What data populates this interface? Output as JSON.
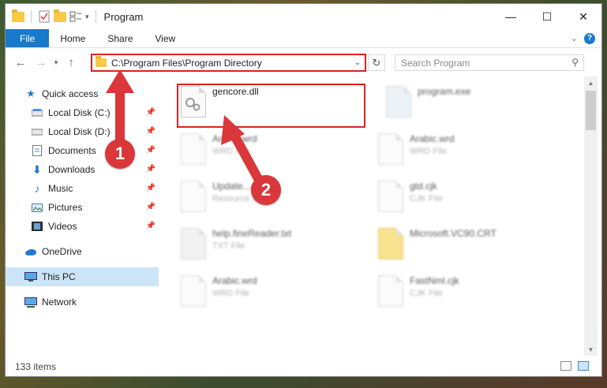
{
  "window": {
    "title": "Program",
    "controls": [
      "—",
      "☐",
      "✕"
    ]
  },
  "ribbon": {
    "tabs": [
      "File",
      "Home",
      "Share",
      "View"
    ]
  },
  "navbar": {
    "address": "C:\\Program Files\\Program Directory",
    "search_placeholder": "Search Program"
  },
  "sidebar": {
    "items": [
      {
        "label": "Quick access",
        "icon": "star-icon"
      },
      {
        "label": "Local Disk (C:)",
        "icon": "drive-icon",
        "pinned": true
      },
      {
        "label": "Local Disk (D:)",
        "icon": "drive-icon",
        "pinned": true
      },
      {
        "label": "Documents",
        "icon": "documents-icon",
        "pinned": true
      },
      {
        "label": "Downloads",
        "icon": "download-icon",
        "pinned": true
      },
      {
        "label": "Music",
        "icon": "music-icon",
        "pinned": true
      },
      {
        "label": "Pictures",
        "icon": "pictures-icon",
        "pinned": true
      },
      {
        "label": "Videos",
        "icon": "videos-icon",
        "pinned": true
      },
      {
        "label": "OneDrive",
        "icon": "cloud-icon"
      },
      {
        "label": "This PC",
        "icon": "computer-icon",
        "selected": true
      },
      {
        "label": "Network",
        "icon": "network-icon"
      }
    ]
  },
  "files": {
    "highlighted": {
      "name": "gencore.dll"
    },
    "items": [
      {
        "name": "program.exe",
        "type": ""
      },
      {
        "name": "Arabic.wrd",
        "type": "WRD File"
      },
      {
        "name": "Arabic.wrd",
        "type": "WRD File"
      },
      {
        "name": "Update...42.dll",
        "type": "Resource..."
      },
      {
        "name": "gtd.cjk",
        "type": "CJK File"
      },
      {
        "name": "help.fineReader.txt",
        "type": "TXT File"
      },
      {
        "name": "Microsoft.VC90.CRT",
        "type": ""
      },
      {
        "name": "Arabic.wrd",
        "type": "WRD File"
      },
      {
        "name": "FastNml.cjk",
        "type": "CJK File"
      }
    ]
  },
  "status": {
    "count": "133 items"
  },
  "annotations": {
    "step1": "1",
    "step2": "2"
  },
  "colors": {
    "accent": "#1979ca",
    "highlight": "#e02020",
    "badge": "#d9373a"
  }
}
